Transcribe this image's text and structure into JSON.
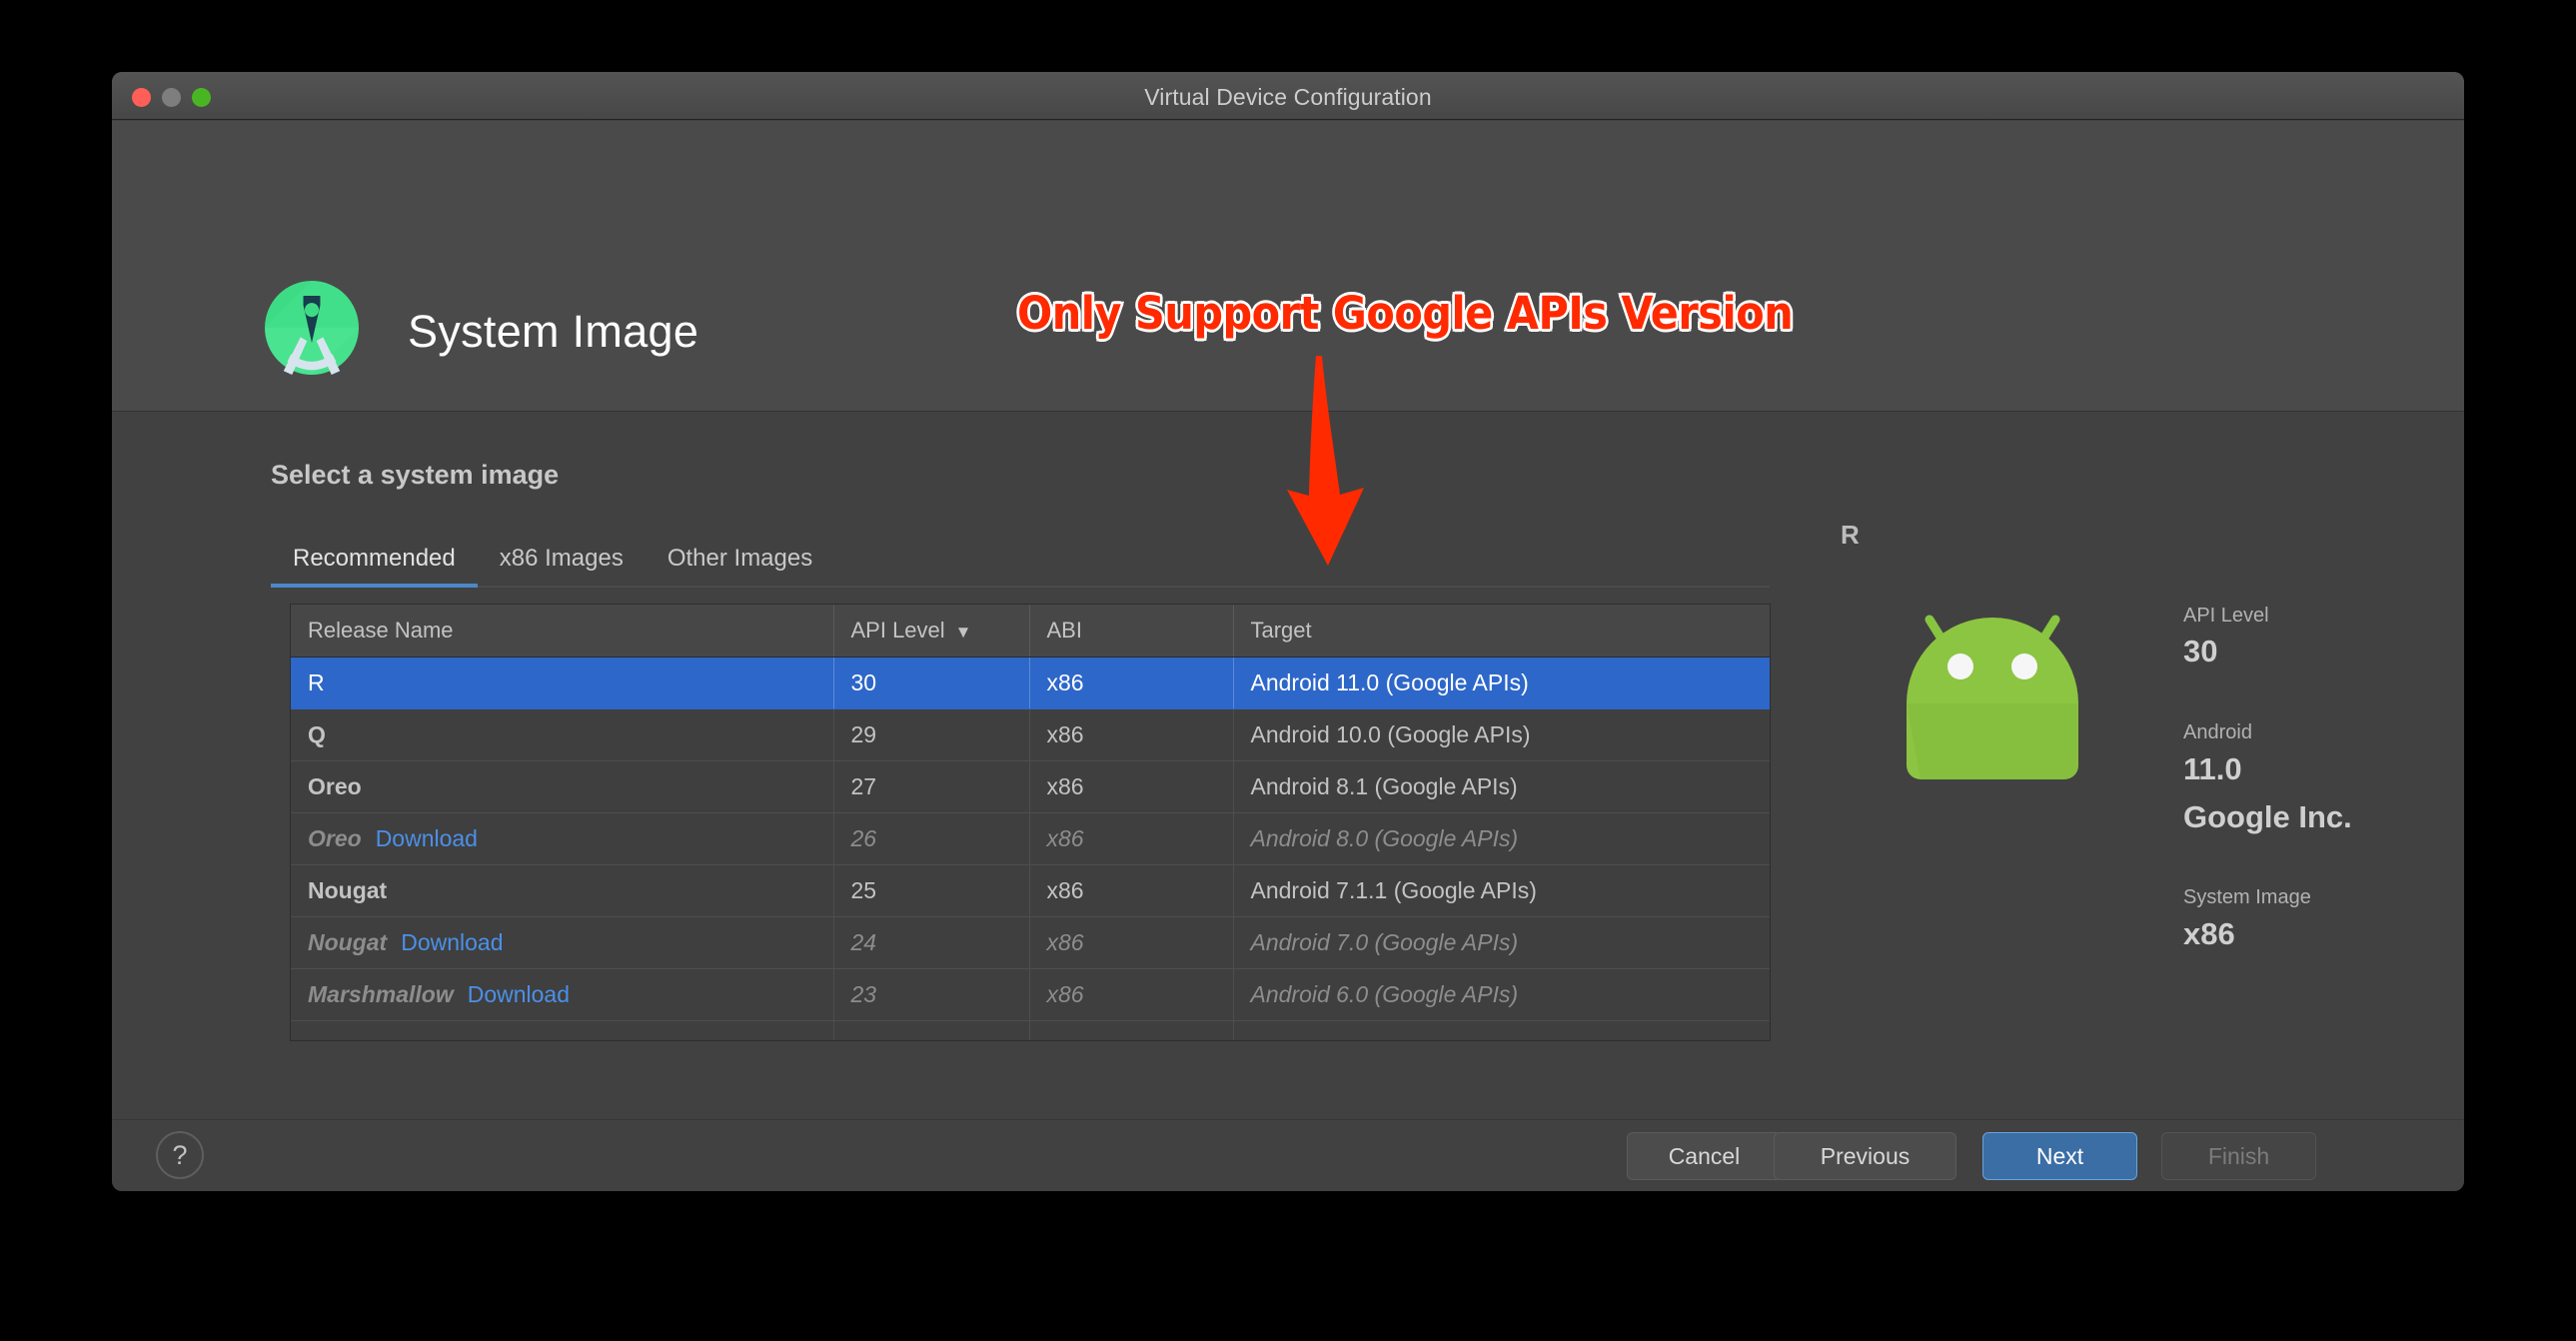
{
  "window": {
    "title": "Virtual Device Configuration",
    "traffic_lights": {
      "close": "close",
      "minimize": "minimize",
      "maximize": "maximize"
    }
  },
  "header": {
    "page_title": "System Image",
    "logo_name": "android-studio-logo"
  },
  "annotation": {
    "text": "Only Support Google APIs Version",
    "color": "#ff2a00",
    "outline_color": "#ffffff",
    "arrow": "down-arrow"
  },
  "main": {
    "section_title": "Select a system image",
    "tabs": [
      {
        "label": "Recommended",
        "active": true
      },
      {
        "label": "x86 Images",
        "active": false
      },
      {
        "label": "Other Images",
        "active": false
      }
    ],
    "table": {
      "columns": [
        {
          "label": "Release Name",
          "sorted": false
        },
        {
          "label": "API Level",
          "sorted": true,
          "sort_icon": "▼"
        },
        {
          "label": "ABI",
          "sorted": false
        },
        {
          "label": "Target",
          "sorted": false
        }
      ],
      "rows": [
        {
          "release": "R",
          "download": "",
          "api": "30",
          "abi": "x86",
          "target": "Android 11.0 (Google APIs)",
          "state": "selected"
        },
        {
          "release": "Q",
          "download": "",
          "api": "29",
          "abi": "x86",
          "target": "Android 10.0 (Google APIs)",
          "state": "installed"
        },
        {
          "release": "Oreo",
          "download": "",
          "api": "27",
          "abi": "x86",
          "target": "Android 8.1 (Google APIs)",
          "state": "installed"
        },
        {
          "release": "Oreo",
          "download": "Download",
          "api": "26",
          "abi": "x86",
          "target": "Android 8.0 (Google APIs)",
          "state": "not-downloaded"
        },
        {
          "release": "Nougat",
          "download": "",
          "api": "25",
          "abi": "x86",
          "target": "Android 7.1.1 (Google APIs)",
          "state": "installed"
        },
        {
          "release": "Nougat",
          "download": "Download",
          "api": "24",
          "abi": "x86",
          "target": "Android 7.0 (Google APIs)",
          "state": "not-downloaded"
        },
        {
          "release": "Marshmallow",
          "download": "Download",
          "api": "23",
          "abi": "x86",
          "target": "Android 6.0 (Google APIs)",
          "state": "not-downloaded"
        }
      ]
    }
  },
  "detail": {
    "name": "R",
    "icon": "android-robot-icon",
    "api_level_label": "API Level",
    "api_level_value": "30",
    "android_label": "Android",
    "android_value": "11.0",
    "vendor": "Google Inc.",
    "system_image_label": "System Image",
    "system_image_value": "x86"
  },
  "footer": {
    "help": "?",
    "cancel": "Cancel",
    "previous": "Previous",
    "next": "Next",
    "finish": "Finish"
  },
  "colors": {
    "accent_blue": "#2d67c9",
    "tab_underline": "#4a88c7",
    "next_button": "#3a6ea5",
    "link_blue": "#4b90e8",
    "annotation_red": "#ff2a00",
    "window_bg": "#414141",
    "header_bg": "#4a4a4a"
  }
}
